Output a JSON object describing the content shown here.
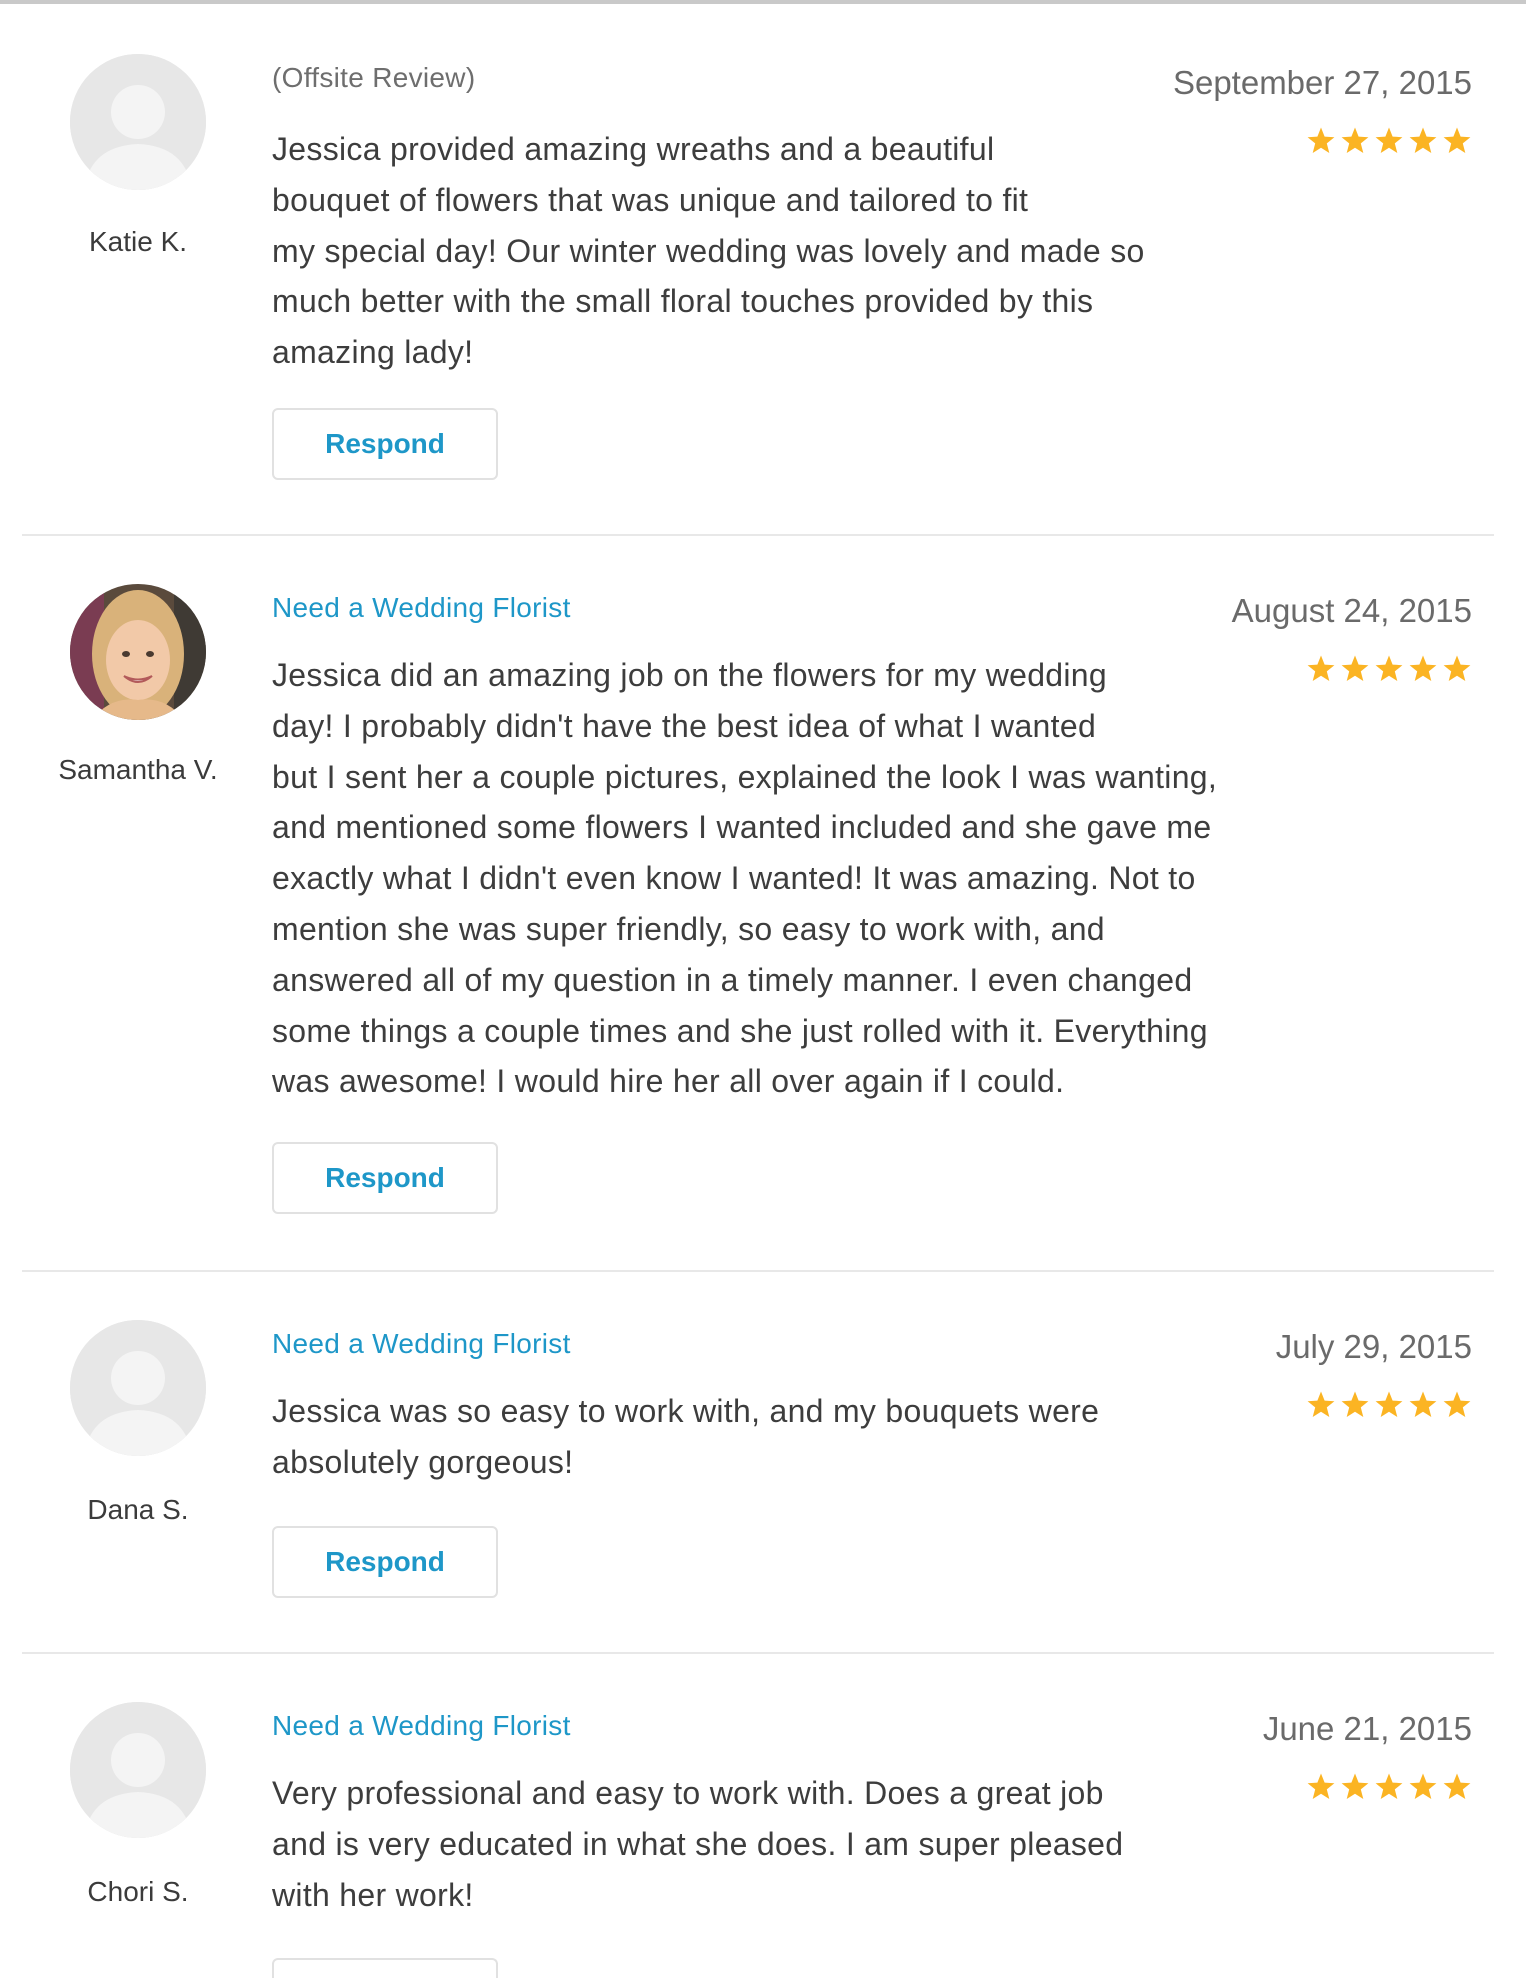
{
  "colors": {
    "accent": "#1e97c8",
    "star": "#fbb423",
    "text": "#3d3d3d",
    "muted": "#6a6a6a",
    "divider": "#e8e8e8",
    "avatar_placeholder": "#e7e7e7"
  },
  "reviews": [
    {
      "reviewer": "Katie K.",
      "avatar": "placeholder-avatar-icon",
      "source": "(Offsite Review)",
      "date": "September 27, 2015",
      "rating": 5,
      "max_rating": 5,
      "text_lines": [
        "Jessica provided amazing wreaths and a beautiful",
        "bouquet of flowers that was unique and tailored to fit",
        "my special day! Our winter wedding was lovely and made so",
        "much better with the small floral touches provided by this",
        "amazing lady!"
      ],
      "respond_label": "Respond"
    },
    {
      "reviewer": "Samantha V.",
      "avatar": "user-photo",
      "source": "Need a Wedding Florist",
      "date": "August 24, 2015",
      "rating": 5,
      "max_rating": 5,
      "text_lines": [
        "Jessica did an amazing job on the flowers for my wedding",
        "day! I probably didn't have the best idea of what I wanted",
        "but I sent her a couple pictures, explained the look I was wanting,",
        "and mentioned some flowers I wanted included and she gave me",
        "exactly what I didn't even know I wanted! It was amazing. Not to",
        "mention she was super friendly, so easy to work with, and",
        "answered all of my question in a timely manner. I even changed",
        "some things a couple times and she just rolled with it. Everything",
        "was awesome! I would hire her all over again if I could."
      ],
      "respond_label": "Respond"
    },
    {
      "reviewer": "Dana S.",
      "avatar": "placeholder-avatar-icon",
      "source": "Need a Wedding Florist",
      "date": "July 29, 2015",
      "rating": 5,
      "max_rating": 5,
      "text_lines": [
        "Jessica was so easy to work with, and my bouquets were",
        "absolutely gorgeous!"
      ],
      "respond_label": "Respond"
    },
    {
      "reviewer": "Chori S.",
      "avatar": "placeholder-avatar-icon",
      "source": "Need a Wedding Florist",
      "date": "June 21, 2015",
      "rating": 5,
      "max_rating": 5,
      "text_lines": [
        "Very professional and easy to work with. Does a great job",
        "and is very educated in what she does. I am super pleased",
        "with her work!"
      ],
      "respond_label": ""
    }
  ]
}
